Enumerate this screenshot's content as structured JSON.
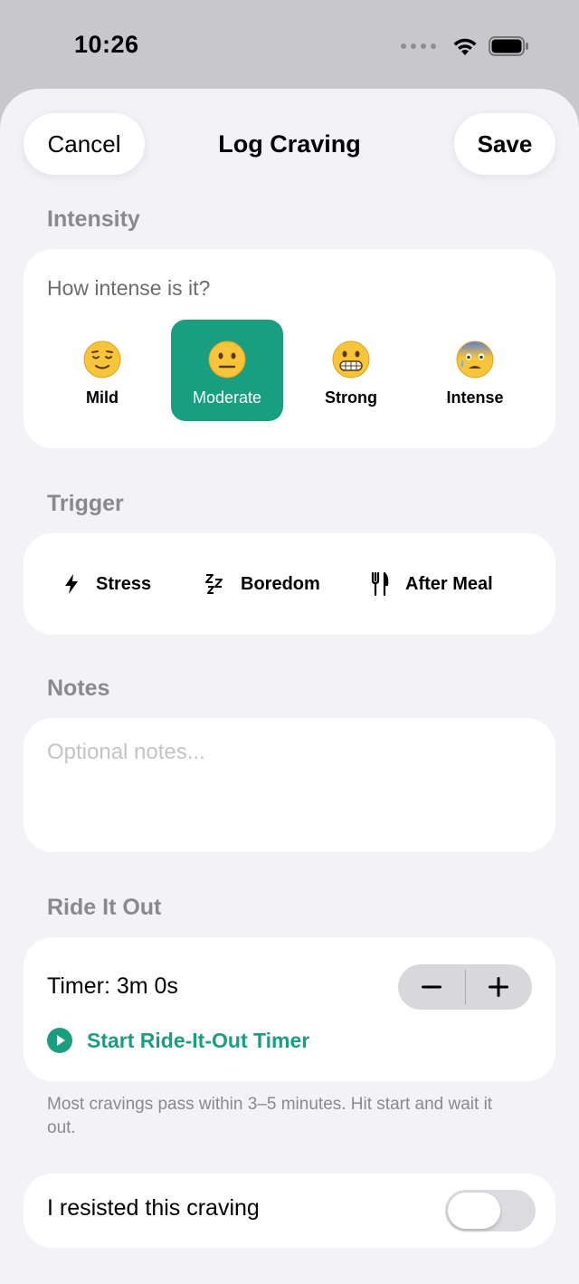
{
  "status_bar": {
    "time": "10:26"
  },
  "nav": {
    "cancel_label": "Cancel",
    "title": "Log Craving",
    "save_label": "Save"
  },
  "intensity": {
    "section_label": "Intensity",
    "prompt": "How intense is it?",
    "selected": "Moderate",
    "options": [
      {
        "label": "Mild",
        "icon": "relieved-face-icon"
      },
      {
        "label": "Moderate",
        "icon": "neutral-face-icon"
      },
      {
        "label": "Strong",
        "icon": "grimacing-face-icon"
      },
      {
        "label": "Intense",
        "icon": "anxious-sweat-face-icon"
      }
    ]
  },
  "trigger": {
    "section_label": "Trigger",
    "options": [
      {
        "label": "Stress",
        "icon": "bolt-icon"
      },
      {
        "label": "Boredom",
        "icon": "zzz-icon"
      },
      {
        "label": "After Meal",
        "icon": "fork-knife-icon"
      }
    ]
  },
  "notes": {
    "section_label": "Notes",
    "placeholder": "Optional notes..."
  },
  "ride_it_out": {
    "section_label": "Ride It Out",
    "timer_label": "Timer: 3m 0s",
    "start_label": "Start Ride-It-Out Timer",
    "footnote": "Most cravings pass within 3–5 minutes. Hit start and wait it out."
  },
  "resisted": {
    "label": "I resisted this craving",
    "value": false
  },
  "colors": {
    "accent": "#1a9e80",
    "background": "#f2f2f7",
    "card": "#ffffff"
  }
}
